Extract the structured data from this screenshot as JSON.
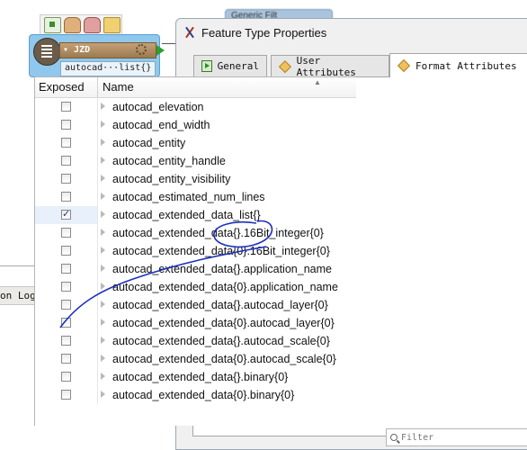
{
  "canvas": {
    "node": {
      "name": "JZD",
      "attribute": "autocad···list{}"
    },
    "background_chip": "Generic Filt",
    "log_panel": {
      "title": "on Log"
    }
  },
  "dialog": {
    "title": "Feature Type Properties",
    "tabs": [
      {
        "label": "General",
        "icon": "general-icon",
        "active": false
      },
      {
        "label": "User Attributes",
        "icon": "diamond-icon",
        "active": false
      },
      {
        "label": "Format Attributes",
        "icon": "diamond-icon",
        "active": true
      }
    ],
    "table": {
      "columns": [
        "Exposed",
        "Name"
      ],
      "rows": [
        {
          "name": "autocad_elevation",
          "exposed": false
        },
        {
          "name": "autocad_end_width",
          "exposed": false
        },
        {
          "name": "autocad_entity",
          "exposed": false
        },
        {
          "name": "autocad_entity_handle",
          "exposed": false
        },
        {
          "name": "autocad_entity_visibility",
          "exposed": false
        },
        {
          "name": "autocad_estimated_num_lines",
          "exposed": false
        },
        {
          "name": "autocad_extended_data_list{}",
          "exposed": true
        },
        {
          "name": "autocad_extended_data{}.16Bit_integer{0}",
          "exposed": false
        },
        {
          "name": "autocad_extended_data{0}.16Bit_integer{0}",
          "exposed": false
        },
        {
          "name": "autocad_extended_data{}.application_name",
          "exposed": false
        },
        {
          "name": "autocad_extended_data{0}.application_name",
          "exposed": false
        },
        {
          "name": "autocad_extended_data{}.autocad_layer{0}",
          "exposed": false
        },
        {
          "name": "autocad_extended_data{0}.autocad_layer{0}",
          "exposed": false
        },
        {
          "name": "autocad_extended_data{}.autocad_scale{0}",
          "exposed": false
        },
        {
          "name": "autocad_extended_data{0}.autocad_scale{0}",
          "exposed": false
        },
        {
          "name": "autocad_extended_data{}.binary{0}",
          "exposed": false
        },
        {
          "name": "autocad_extended_data{0}.binary{0}",
          "exposed": false
        }
      ]
    },
    "filter": {
      "placeholder": "Filter",
      "value": ""
    }
  },
  "colors": {
    "node_body": "#8fc8ec",
    "annotation_ink": "#1a2fbf",
    "selected_row": "#e8f0fb"
  }
}
